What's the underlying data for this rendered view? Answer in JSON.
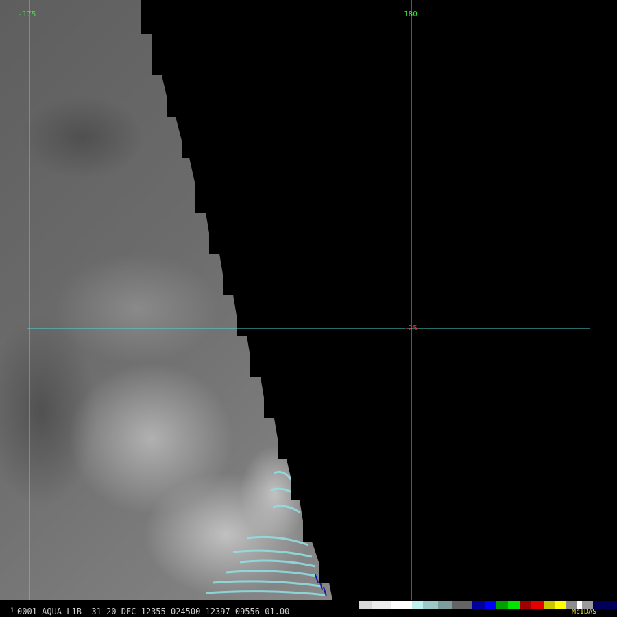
{
  "map": {
    "longitude_labels": [
      "-175",
      "180"
    ],
    "latitude_labels": [
      "-25"
    ],
    "colors": {
      "grid_line": "#4fd6d6",
      "longitude_label": "#32e632",
      "latitude_label": "#e83232",
      "background": "#000000",
      "cloud_bright": "#8fe1e6",
      "cold_edge": "#1a1aa0"
    }
  },
  "info_bar": {
    "frame_number": "1",
    "text": "0001 AQUA-L1B  31 20 DEC 12355 024500 12397 09556 01.00",
    "brand": "McIDAS",
    "brand_color": "#e6e632",
    "text_color": "#d0d0d0",
    "color_scale": [
      "#d8d8d8",
      "#ececec",
      "#ffffff",
      "#bff0f0",
      "#9cc8c8",
      "#7e9e9e",
      "#646464",
      "#0000a0",
      "#0000ff",
      "#00a000",
      "#00e600",
      "#a00000",
      "#e60000",
      "#c8c800",
      "#ffff00",
      "#8c8c8c",
      "#ffffff",
      "#9a9a9a",
      "#00005a"
    ]
  }
}
